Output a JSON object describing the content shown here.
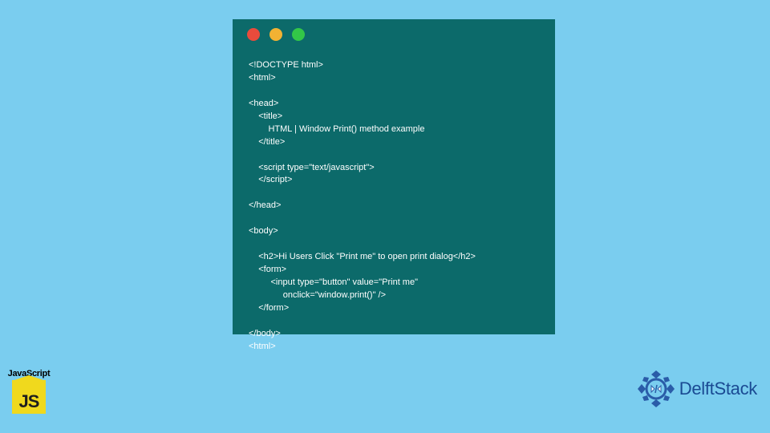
{
  "codeWindow": {
    "dots": [
      "red",
      "yellow",
      "green"
    ],
    "lines": [
      "<!DOCTYPE html>",
      "<html>",
      "",
      "<head>",
      "    <title>",
      "        HTML | Window Print() method example",
      "    </title>",
      "",
      "    <script type=\"text/javascript\">",
      "    </script>",
      "",
      "</head>",
      "",
      "<body>",
      "",
      "    <h2>Hi Users Click \"Print me\" to open print dialog</h2>",
      "    <form>",
      "         <input type=\"button\" value=\"Print me\"",
      "              onclick=\"window.print()\" />",
      "    </form>",
      "",
      "</body>",
      "<html>"
    ]
  },
  "jsBadge": {
    "label": "JavaScript",
    "iconText": "JS"
  },
  "delft": {
    "brand": "DelftStack"
  }
}
